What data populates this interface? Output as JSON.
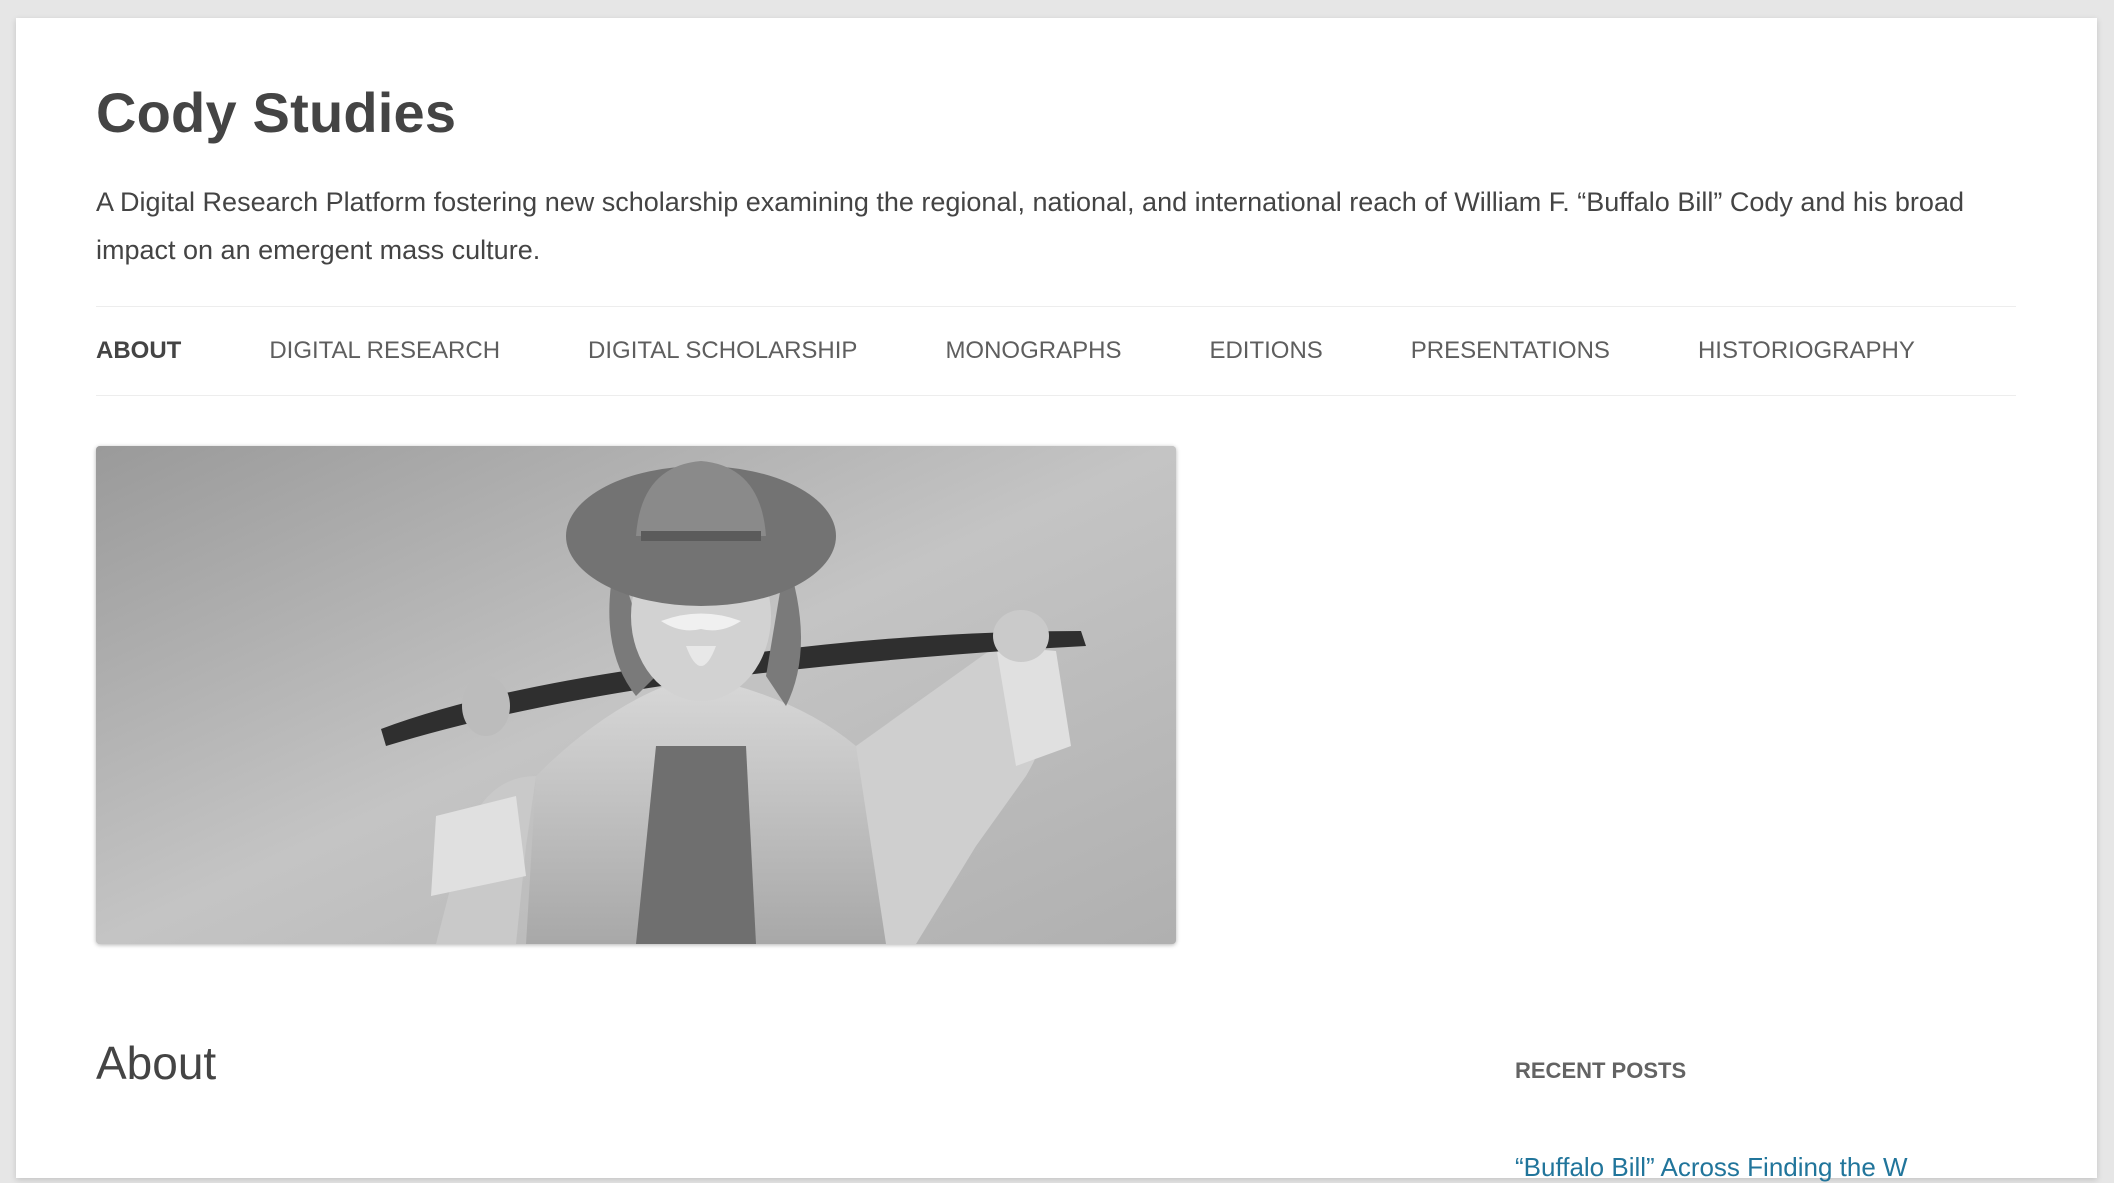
{
  "site": {
    "title": "Cody Studies",
    "description": "A Digital Research Platform fostering new scholarship examining the regional, national, and international reach of William F. “Buffalo Bill” Cody and his broad impact on an emergent mass culture."
  },
  "nav": {
    "items": [
      {
        "label": "About",
        "current": true
      },
      {
        "label": "Digital Research",
        "current": false
      },
      {
        "label": "Digital Scholarship",
        "current": false
      },
      {
        "label": "Monographs",
        "current": false
      },
      {
        "label": "Editions",
        "current": false
      },
      {
        "label": "Presentations",
        "current": false
      },
      {
        "label": "Historiography",
        "current": false
      }
    ]
  },
  "header_image": {
    "subject": "black-and-white portrait photo of a man in a wide-brimmed hat and fringed buckskin jacket holding a rifle across his shoulders"
  },
  "content": {
    "page_title": "About"
  },
  "sidebar": {
    "widget_title": "Recent Posts",
    "first_post": "“Buffalo Bill” Across Finding the W"
  },
  "colors": {
    "background": "#e6e6e6",
    "page": "#ffffff",
    "text": "#444444",
    "link": "#21759b"
  }
}
